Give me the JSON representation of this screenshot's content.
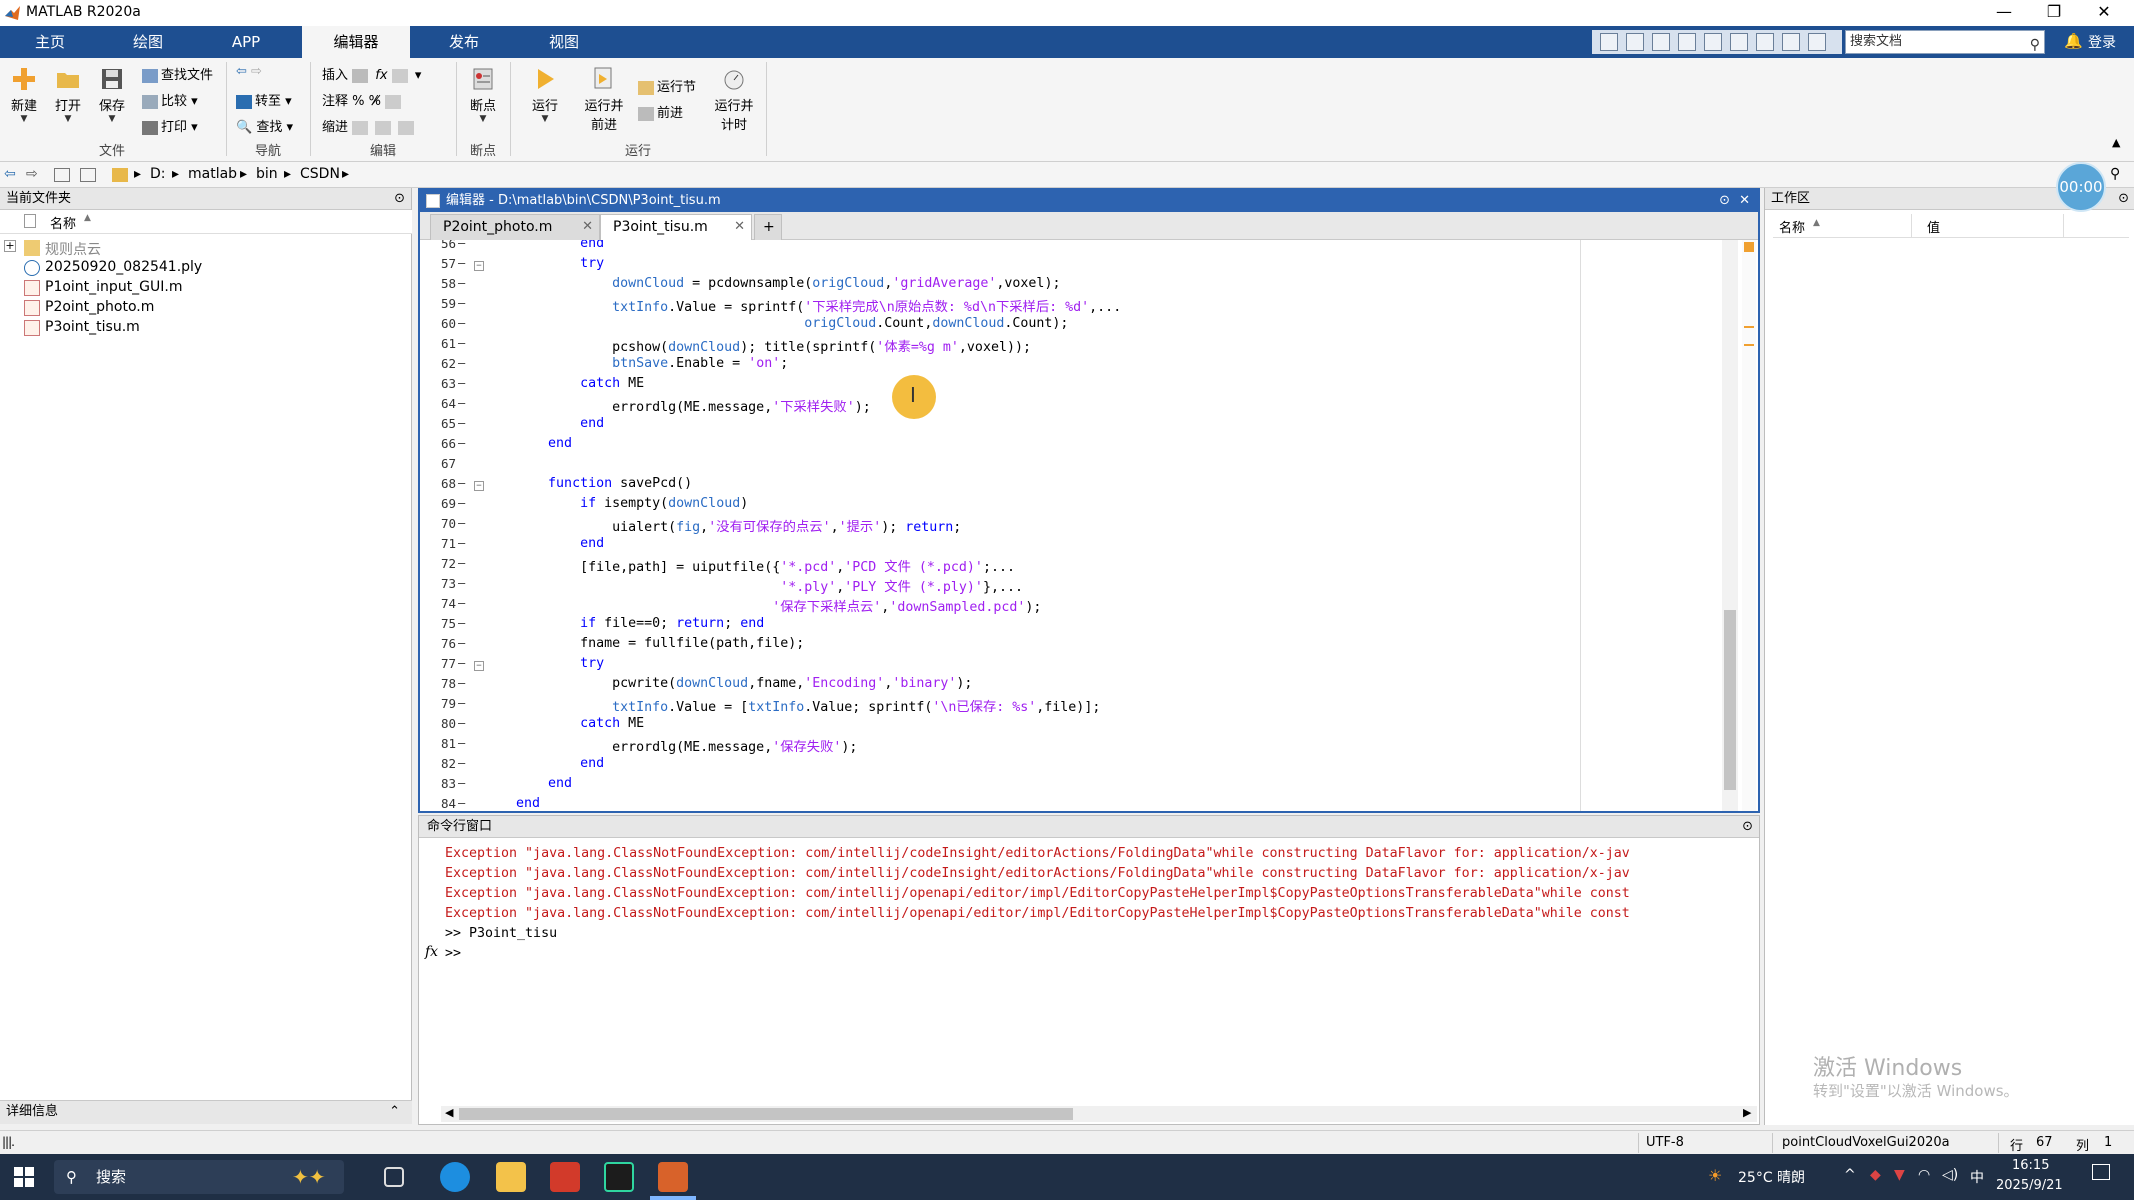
{
  "window": {
    "title": "MATLAB R2020a"
  },
  "ribbon": {
    "tabs": [
      "主页",
      "绘图",
      "APP",
      "编辑器",
      "发布",
      "视图"
    ],
    "active_tab": "编辑器",
    "search_placeholder": "搜索文档",
    "login": "登录",
    "buttons": {
      "new": "新建",
      "open": "打开",
      "save": "保存",
      "find_files": "查找文件",
      "compare": "比较",
      "print": "打印",
      "goto": "转至",
      "find": "查找",
      "insert": "插入",
      "comment": "注释",
      "indent": "缩进",
      "breakpoints": "断点",
      "run": "运行",
      "run_advance": [
        "运行并",
        "前进"
      ],
      "run_section": "运行节",
      "advance": "前进",
      "run_time": [
        "运行并",
        "计时"
      ]
    },
    "groups": {
      "file": "文件",
      "navigate": "导航",
      "edit": "编辑",
      "breakpoints": "断点",
      "run": "运行"
    }
  },
  "address": {
    "parts": [
      "D:",
      "matlab",
      "bin",
      "CSDN"
    ]
  },
  "file_panel": {
    "title": "当前文件夹",
    "column": "名称",
    "items": [
      {
        "name": "规则点云",
        "type": "folder"
      },
      {
        "name": "20250920_082541.ply",
        "type": "ply"
      },
      {
        "name": "P1oint_input_GUI.m",
        "type": "m"
      },
      {
        "name": "P2oint_photo.m",
        "type": "m"
      },
      {
        "name": "P3oint_tisu.m",
        "type": "m"
      }
    ],
    "details": "详细信息"
  },
  "editor": {
    "title": "编辑器 - D:\\matlab\\bin\\CSDN\\P3oint_tisu.m",
    "tabs": [
      "P2oint_photo.m",
      "P3oint_tisu.m"
    ],
    "active_tab": "P3oint_tisu.m",
    "lines": [
      {
        "n": "56",
        "text": "            end"
      },
      {
        "n": "57",
        "text": "            try"
      },
      {
        "n": "58",
        "text": "                downCloud = pcdownsample(origCloud,'gridAverage',voxel);"
      },
      {
        "n": "59",
        "text": "                txtInfo.Value = sprintf('下采样完成\\n原始点数: %d\\n下采样后: %d',..."
      },
      {
        "n": "60",
        "text": "                                        origCloud.Count,downCloud.Count);"
      },
      {
        "n": "61",
        "text": "                pcshow(downCloud); title(sprintf('体素=%g m',voxel));"
      },
      {
        "n": "62",
        "text": "                btnSave.Enable = 'on';"
      },
      {
        "n": "63",
        "text": "            catch ME"
      },
      {
        "n": "64",
        "text": "                errordlg(ME.message,'下采样失败');"
      },
      {
        "n": "65",
        "text": "            end"
      },
      {
        "n": "66",
        "text": "        end"
      },
      {
        "n": "67",
        "text": ""
      },
      {
        "n": "68",
        "text": "        function savePcd()"
      },
      {
        "n": "69",
        "text": "            if isempty(downCloud)"
      },
      {
        "n": "70",
        "text": "                uialert(fig,'没有可保存的点云','提示'); return;"
      },
      {
        "n": "71",
        "text": "            end"
      },
      {
        "n": "72",
        "text": "            [file,path] = uiputfile({'*.pcd','PCD 文件 (*.pcd)';..."
      },
      {
        "n": "73",
        "text": "                                     '*.ply','PLY 文件 (*.ply)'},..."
      },
      {
        "n": "74",
        "text": "                                    '保存下采样点云','downSampled.pcd');"
      },
      {
        "n": "75",
        "text": "            if file==0; return; end"
      },
      {
        "n": "76",
        "text": "            fname = fullfile(path,file);"
      },
      {
        "n": "77",
        "text": "            try"
      },
      {
        "n": "78",
        "text": "                pcwrite(downCloud,fname,'Encoding','binary');"
      },
      {
        "n": "79",
        "text": "                txtInfo.Value = [txtInfo.Value; sprintf('\\n已保存: %s',file)];"
      },
      {
        "n": "80",
        "text": "            catch ME"
      },
      {
        "n": "81",
        "text": "                errordlg(ME.message,'保存失败');"
      },
      {
        "n": "82",
        "text": "            end"
      },
      {
        "n": "83",
        "text": "        end"
      },
      {
        "n": "84",
        "text": "    end"
      }
    ]
  },
  "command_window": {
    "title": "命令行窗口",
    "lines": [
      {
        "text": "Exception \"java.lang.ClassNotFoundException: com/intellij/codeInsight/editorActions/FoldingData\"while constructing DataFlavor for: application/x-jav",
        "type": "error"
      },
      {
        "text": "Exception \"java.lang.ClassNotFoundException: com/intellij/codeInsight/editorActions/FoldingData\"while constructing DataFlavor for: application/x-jav",
        "type": "error"
      },
      {
        "text": "Exception \"java.lang.ClassNotFoundException: com/intellij/openapi/editor/impl/EditorCopyPasteHelperImpl$CopyPasteOptionsTransferableData\"while const",
        "type": "error"
      },
      {
        "text": "Exception \"java.lang.ClassNotFoundException: com/intellij/openapi/editor/impl/EditorCopyPasteHelperImpl$CopyPasteOptionsTransferableData\"while const",
        "type": "error"
      },
      {
        "text": ">> P3oint_tisu",
        "type": "normal"
      },
      {
        "text": ">>",
        "type": "prompt"
      }
    ],
    "fx": "fx"
  },
  "workspace": {
    "title": "工作区",
    "col_name": "名称",
    "col_value": "值",
    "watermark_line1": "激活 Windows",
    "watermark_line2": "转到\"设置\"以激活 Windows。"
  },
  "timer": "00:00",
  "status": {
    "encoding": "UTF-8",
    "function": "pointCloudVoxelGui2020a",
    "row_label": "行",
    "row": "67",
    "col_label": "列",
    "col": "1"
  },
  "taskbar": {
    "search": "搜索",
    "weather": "25°C 晴朗",
    "ime": "中",
    "time": "16:15",
    "date": "2025/9/21"
  },
  "colors": {
    "ribbon_blue": "#1e4f91",
    "editor_blue": "#2d63b0",
    "error_red": "#c41a1a",
    "string_purple": "#a020f0",
    "var_blue": "#2b6cc4"
  }
}
